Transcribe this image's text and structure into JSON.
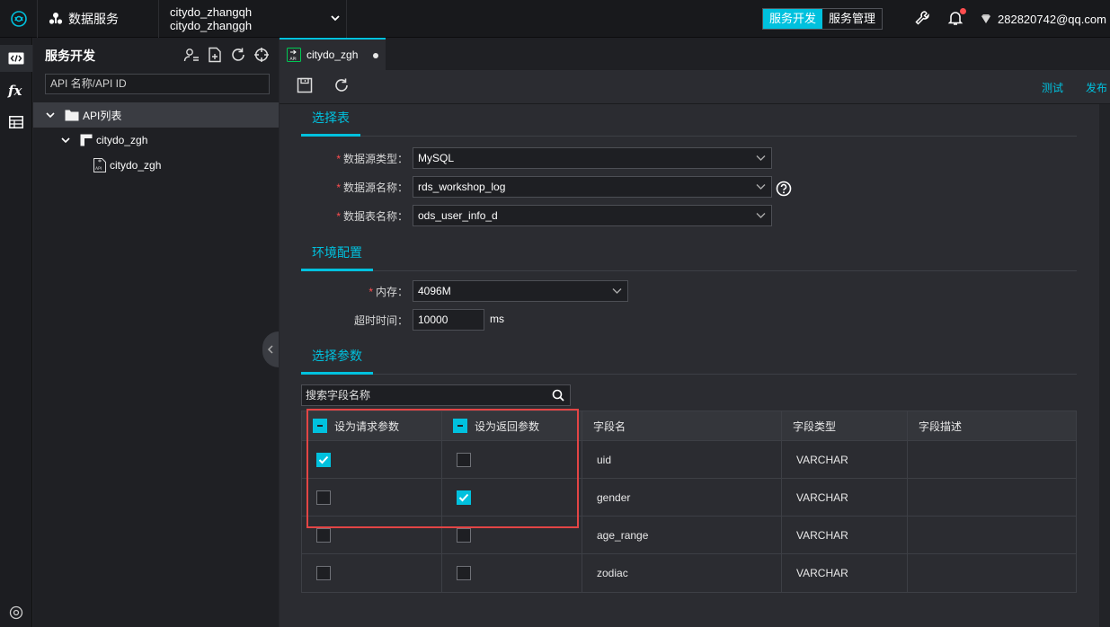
{
  "topbar": {
    "product_name": "数据服务",
    "workspace_line1": "citydo_zhangqh",
    "workspace_line2": "citydo_zhanggh",
    "mode_dev": "服务开发",
    "mode_manage": "服务管理",
    "user_email": "282820742@qq.com"
  },
  "sidebar": {
    "title": "服务开发",
    "search_placeholder": "API 名称/API ID",
    "tree": [
      {
        "label": "API列表"
      },
      {
        "label": "citydo_zgh"
      },
      {
        "label": "citydo_zgh"
      }
    ]
  },
  "editor": {
    "tab_label": "citydo_zgh",
    "action_test": "测试",
    "action_publish": "发布"
  },
  "select_table": {
    "heading": "选择表",
    "ds_type_label": "数据源类型：",
    "ds_type_value": "MySQL",
    "ds_name_label": "数据源名称：",
    "ds_name_value": "rds_workshop_log",
    "table_label": "数据表名称：",
    "table_value": "ods_user_info_d"
  },
  "env_config": {
    "heading": "环境配置",
    "memory_label": "内存：",
    "memory_value": "4096M",
    "timeout_label": "超时时间：",
    "timeout_value": "10000",
    "timeout_unit": "ms"
  },
  "params": {
    "heading": "选择参数",
    "search_placeholder": "搜索字段名称",
    "columns": [
      "设为请求参数",
      "设为返回参数",
      "字段名",
      "字段类型",
      "字段描述"
    ],
    "rows": [
      {
        "field": "uid",
        "type": "VARCHAR",
        "desc": "",
        "request": true,
        "response": false
      },
      {
        "field": "gender",
        "type": "VARCHAR",
        "desc": "",
        "request": false,
        "response": true
      },
      {
        "field": "age_range",
        "type": "VARCHAR",
        "desc": "",
        "request": false,
        "response": false
      },
      {
        "field": "zodiac",
        "type": "VARCHAR",
        "desc": "",
        "request": false,
        "response": false
      }
    ]
  },
  "colors": {
    "accent": "#00c1de",
    "highlight": "#e34545",
    "required": "#ff4d4f"
  }
}
